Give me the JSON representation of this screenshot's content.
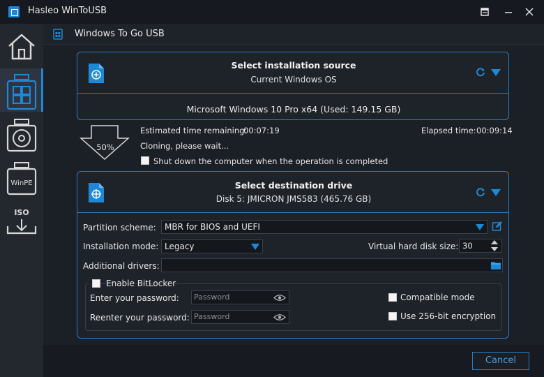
{
  "app": {
    "title": "Hasleo WinToUSB"
  },
  "header": {
    "title": "Windows To Go USB"
  },
  "sidebar": {
    "items": [
      {
        "name": "home",
        "icon": "home-icon"
      },
      {
        "name": "windows-to-go-usb",
        "icon": "windows-usb-icon",
        "active": true
      },
      {
        "name": "disc-to-usb",
        "icon": "disc-usb-icon"
      },
      {
        "name": "winpe-to-usb",
        "icon": "winpe-icon",
        "label": "WinPE"
      },
      {
        "name": "iso-to-usb",
        "icon": "iso-download-icon",
        "label": "ISO"
      }
    ]
  },
  "source": {
    "title": "Select installation source",
    "subtitle": "Current Windows OS",
    "info": "Microsoft Windows 10 Pro x64 (Used: 149.15 GB)"
  },
  "progress": {
    "percent_label": "50%",
    "percent": 50,
    "estimated_label": "Estimated time remaining:",
    "estimated_value": "00:07:19",
    "elapsed_label": "Elapsed time:",
    "elapsed_value": "00:09:14",
    "status": "Cloning, please wait...",
    "shutdown_label": "Shut down the computer when the operation is completed"
  },
  "destination": {
    "title": "Select destination drive",
    "subtitle": "Disk 5: JMICRON JMS583 (465.76 GB)"
  },
  "form": {
    "partition_label": "Partition scheme:",
    "partition_value": "MBR for BIOS and UEFI",
    "mode_label": "Installation mode:",
    "mode_value": "Legacy",
    "vhd_label": "Virtual hard disk size:",
    "vhd_value": "30",
    "drivers_label": "Additional drivers:",
    "drivers_value": "",
    "bitlocker_label": "Enable BitLocker",
    "password_label": "Enter your password:",
    "password_placeholder": "Password",
    "reenter_label": "Reenter your password:",
    "reenter_placeholder": "Password",
    "compatible_label": "Compatible mode",
    "encryption_label": "Use 256-bit encryption"
  },
  "footer": {
    "cancel_label": "Cancel"
  },
  "colors": {
    "accent": "#2c7bc4",
    "icon_blue": "#1e88d8"
  }
}
